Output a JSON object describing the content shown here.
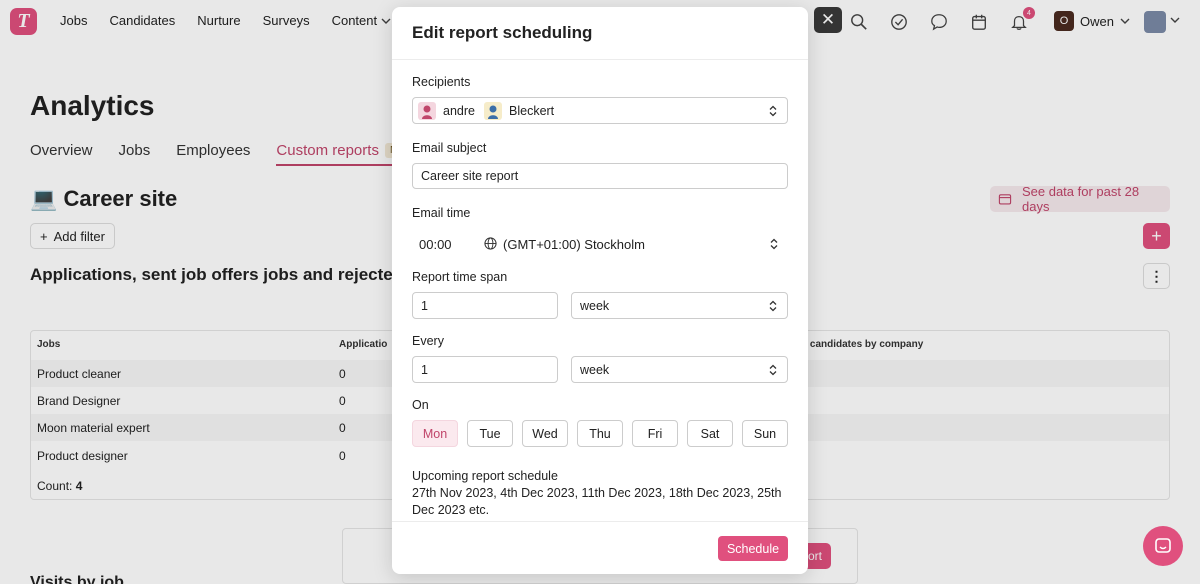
{
  "app": {
    "logo_letter": "T",
    "nav": [
      "Jobs",
      "Candidates",
      "Nurture",
      "Surveys",
      "Content"
    ],
    "notification_count": "4",
    "user": {
      "initial": "O",
      "name": "Owen"
    },
    "accent": "#e0507e"
  },
  "page": {
    "title": "Analytics",
    "tabs": [
      "Overview",
      "Jobs",
      "Employees",
      "Custom reports"
    ],
    "new_tag": "New",
    "section_title": "💻 Career site",
    "add_filter": "Add filter",
    "see_data": "See data for past 28 days",
    "report_title": "Applications, sent job offers jobs and rejected"
  },
  "table": {
    "headers": [
      "Jobs",
      "Applicatio",
      "d candidates by company"
    ],
    "rows": [
      {
        "job": "Product cleaner",
        "value": "0"
      },
      {
        "job": "Brand Designer",
        "value": "0"
      },
      {
        "job": "Moon material expert",
        "value": "0"
      },
      {
        "job": "Product designer",
        "value": "0"
      }
    ],
    "count_label": "Count:",
    "count_value": "4"
  },
  "bottom": {
    "button_tail": "ort",
    "section_partial": "Visits by job"
  },
  "modal": {
    "title": "Edit report scheduling",
    "recipients_label": "Recipients",
    "recipients": [
      "andre",
      "Bleckert"
    ],
    "subject_label": "Email subject",
    "subject_value": "Career site report",
    "time_label": "Email time",
    "time_value": "00:00",
    "timezone": "(GMT+01:00) Stockholm",
    "span_label": "Report time span",
    "span_value": "1",
    "span_unit": "week",
    "every_label": "Every",
    "every_value": "1",
    "every_unit": "week",
    "on_label": "On",
    "days": [
      "Mon",
      "Tue",
      "Wed",
      "Thu",
      "Fri",
      "Sat",
      "Sun"
    ],
    "selected_day": "Mon",
    "upcoming_label": "Upcoming report schedule",
    "upcoming_dates": "27th Nov 2023, 4th Dec 2023, 11th Dec 2023, 18th Dec 2023, 25th Dec 2023 etc.",
    "schedule_button": "Schedule"
  }
}
